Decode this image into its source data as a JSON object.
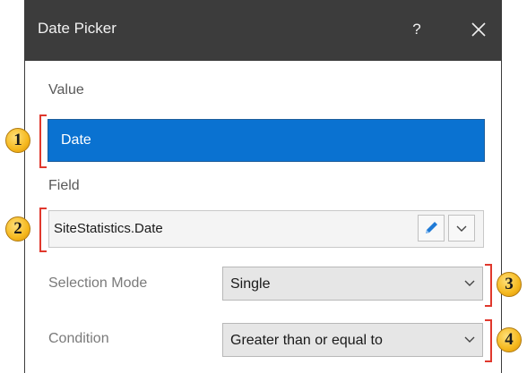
{
  "dialog": {
    "title": "Date Picker",
    "help_label": "?",
    "close_icon": "close-icon"
  },
  "value_section": {
    "label": "Value",
    "selected_item": "Date"
  },
  "field_section": {
    "label": "Field",
    "value": "SiteStatistics.Date",
    "edit_icon": "pencil-icon",
    "dropdown_icon": "chevron-down-icon"
  },
  "selection_mode": {
    "label": "Selection Mode",
    "value": "Single"
  },
  "condition": {
    "label": "Condition",
    "value": "Greater than or equal to"
  },
  "callouts": [
    "1",
    "2",
    "3",
    "4"
  ],
  "colors": {
    "titlebar": "#3c3c3c",
    "selection": "#0a72d1",
    "callout_bracket": "#e0382d",
    "badge": "#f5b81d"
  }
}
